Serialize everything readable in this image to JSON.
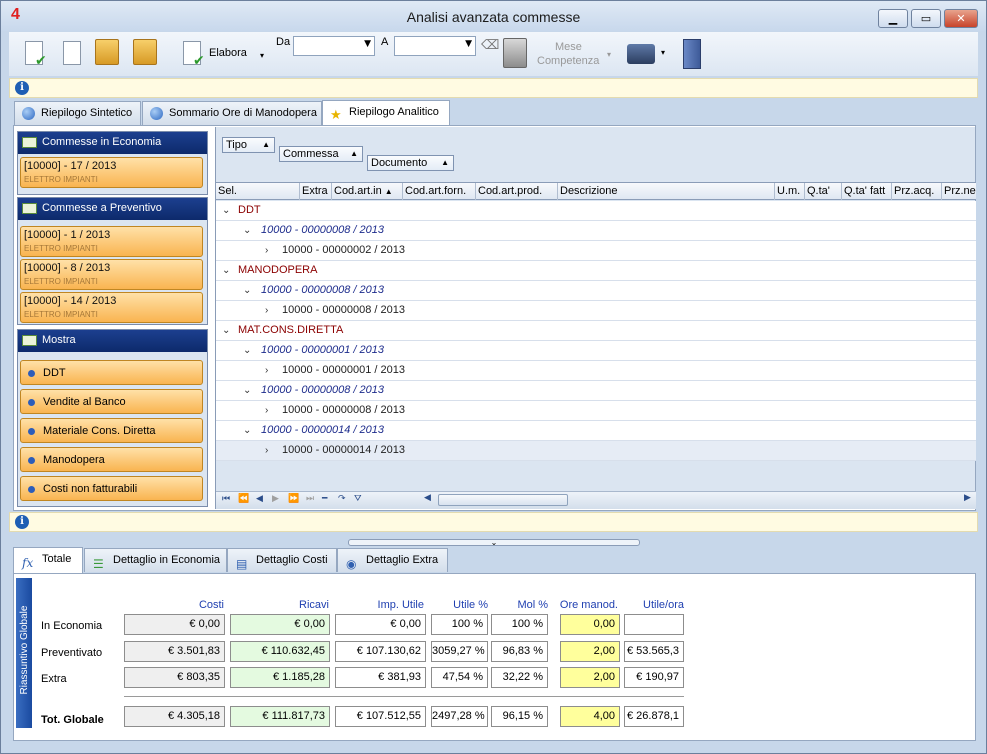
{
  "window": {
    "title": "Analisi avanzata commesse",
    "app_icon": "4"
  },
  "toolbar": {
    "elabora": "Elabora",
    "da_label": "Da",
    "a_label": "A",
    "mese_line1": "Mese",
    "mese_line2": "Competenza"
  },
  "tabs": [
    {
      "label": "Riepilogo Sintetico"
    },
    {
      "label": "Sommario Ore di Manodopera"
    },
    {
      "label": "Riepilogo Analitico"
    }
  ],
  "sidebar": {
    "economia": {
      "title": "Commesse in Economia",
      "items": [
        {
          "code": "[10000] - 17 / 2013",
          "client": "ELETTRO IMPIANTI"
        }
      ]
    },
    "preventivo": {
      "title": "Commesse a Preventivo",
      "items": [
        {
          "code": "[10000] - 1 / 2013",
          "client": "ELETTRO IMPIANTI"
        },
        {
          "code": "[10000] - 8 / 2013",
          "client": "ELETTRO IMPIANTI"
        },
        {
          "code": "[10000] - 14 / 2013",
          "client": "ELETTRO IMPIANTI"
        }
      ]
    },
    "mostra": {
      "title": "Mostra",
      "items": [
        {
          "label": "DDT"
        },
        {
          "label": "Vendite al Banco"
        },
        {
          "label": "Materiale Cons. Diretta"
        },
        {
          "label": "Manodopera"
        },
        {
          "label": "Costi non fatturabili"
        }
      ]
    }
  },
  "grid": {
    "groups": [
      "Tipo",
      "Commessa",
      "Documento"
    ],
    "columns": [
      "Sel.",
      "Extra",
      "Cod.art.in",
      "Cod.art.forn.",
      "Cod.art.prod.",
      "Descrizione",
      "U.m.",
      "Q.ta'",
      "Q.ta' fatt",
      "Prz.acq.",
      "Prz.ne"
    ],
    "rows": [
      {
        "level": 0,
        "text": "DDT"
      },
      {
        "level": 1,
        "text": "10000 - 00000008 / 2013"
      },
      {
        "level": 2,
        "text": "10000 - 00000002 / 2013"
      },
      {
        "level": 0,
        "text": "MANODOPERA"
      },
      {
        "level": 1,
        "text": "10000 - 00000008 / 2013"
      },
      {
        "level": 2,
        "text": "10000 - 00000008 / 2013"
      },
      {
        "level": 0,
        "text": "MAT.CONS.DIRETTA"
      },
      {
        "level": 1,
        "text": "10000 - 00000001 / 2013"
      },
      {
        "level": 2,
        "text": "10000 - 00000001 / 2013"
      },
      {
        "level": 1,
        "text": "10000 - 00000008 / 2013"
      },
      {
        "level": 2,
        "text": "10000 - 00000008 / 2013"
      },
      {
        "level": 1,
        "text": "10000 - 00000014 / 2013"
      },
      {
        "level": 2,
        "text": "10000 - 00000014 / 2013"
      }
    ]
  },
  "bottom_tabs": [
    {
      "label": "Totale",
      "icon": "fx-icon"
    },
    {
      "label": "Dettaglio in Economia",
      "icon": "list-icon"
    },
    {
      "label": "Dettaglio Costi",
      "icon": "cost-icon"
    },
    {
      "label": "Dettaglio Extra",
      "icon": "extra-icon"
    }
  ],
  "summary": {
    "side_label": "Riassuntivo Globale",
    "headers": [
      "Costi",
      "Ricavi",
      "Imp. Utile",
      "Utile %",
      "Mol %",
      "Ore manod.",
      "Utile/ora"
    ],
    "rows": [
      {
        "label": "In Economia",
        "values": [
          "€ 0,00",
          "€ 0,00",
          "€ 0,00",
          "100 %",
          "100 %",
          "0,00",
          ""
        ]
      },
      {
        "label": "Preventivato",
        "values": [
          "€ 3.501,83",
          "€ 110.632,45",
          "€ 107.130,62",
          "3059,27 %",
          "96,83 %",
          "2,00",
          "€ 53.565,3"
        ]
      },
      {
        "label": "Extra",
        "values": [
          "€ 803,35",
          "€ 1.185,28",
          "€ 381,93",
          "47,54 %",
          "32,22 %",
          "2,00",
          "€ 190,97"
        ]
      },
      {
        "label": "Tot. Globale",
        "values": [
          "€ 4.305,18",
          "€ 111.817,73",
          "€ 107.512,55",
          "2497,28 %",
          "96,15 %",
          "4,00",
          "€ 26.878,1"
        ]
      }
    ]
  }
}
